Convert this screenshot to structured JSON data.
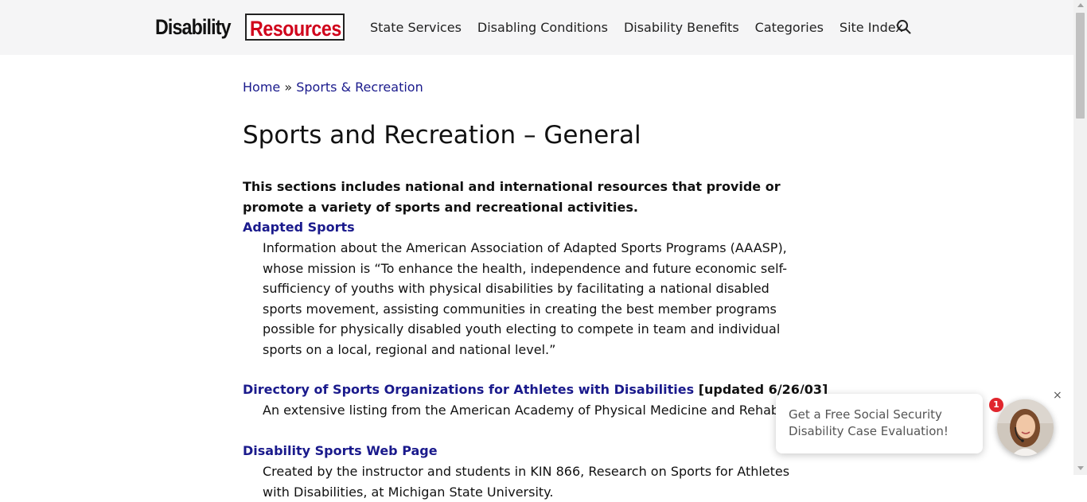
{
  "header": {
    "logo_part1": "Disability",
    "logo_part2": "Resources",
    "nav": [
      "State Services",
      "Disabling Conditions",
      "Disability Benefits",
      "Categories",
      "Site Index"
    ],
    "search_icon": "search-icon"
  },
  "breadcrumb": {
    "home": "Home",
    "separator": " » ",
    "current": "Sports & Recreation"
  },
  "page": {
    "title": "Sports and Recreation – General",
    "intro": "This sections includes national and international resources that provide or promote a variety of sports and recreational activities.",
    "entries": [
      {
        "title": "Adapted Sports",
        "tag": "",
        "desc": "Information about the American Association of Adapted Sports Programs (AAASP), whose mission is “To enhance the health, independence and future economic self-sufficiency of youths with physical disabilities by facilitating a national disabled sports movement, assisting communities in creating the best member programs possible for physically disabled youth electing to compete in team and individual sports on a local, regional and national level.”"
      },
      {
        "title": "Directory of Sports Organizations for Athletes with Disabilities",
        "tag": " [updated 6/26/03]",
        "desc": "An extensive listing from the American Academy of Physical Medicine and Rehabilitation."
      },
      {
        "title": "Disability Sports Web Page",
        "tag": "",
        "desc": "Created by the instructor and students in KIN 866, Research on Sports for Athletes with Disabilities, at Michigan State University."
      }
    ]
  },
  "chat_popup": {
    "text": "Get a Free Social Security Disability Case Evaluation!",
    "badge_count": "1",
    "close": "×"
  }
}
